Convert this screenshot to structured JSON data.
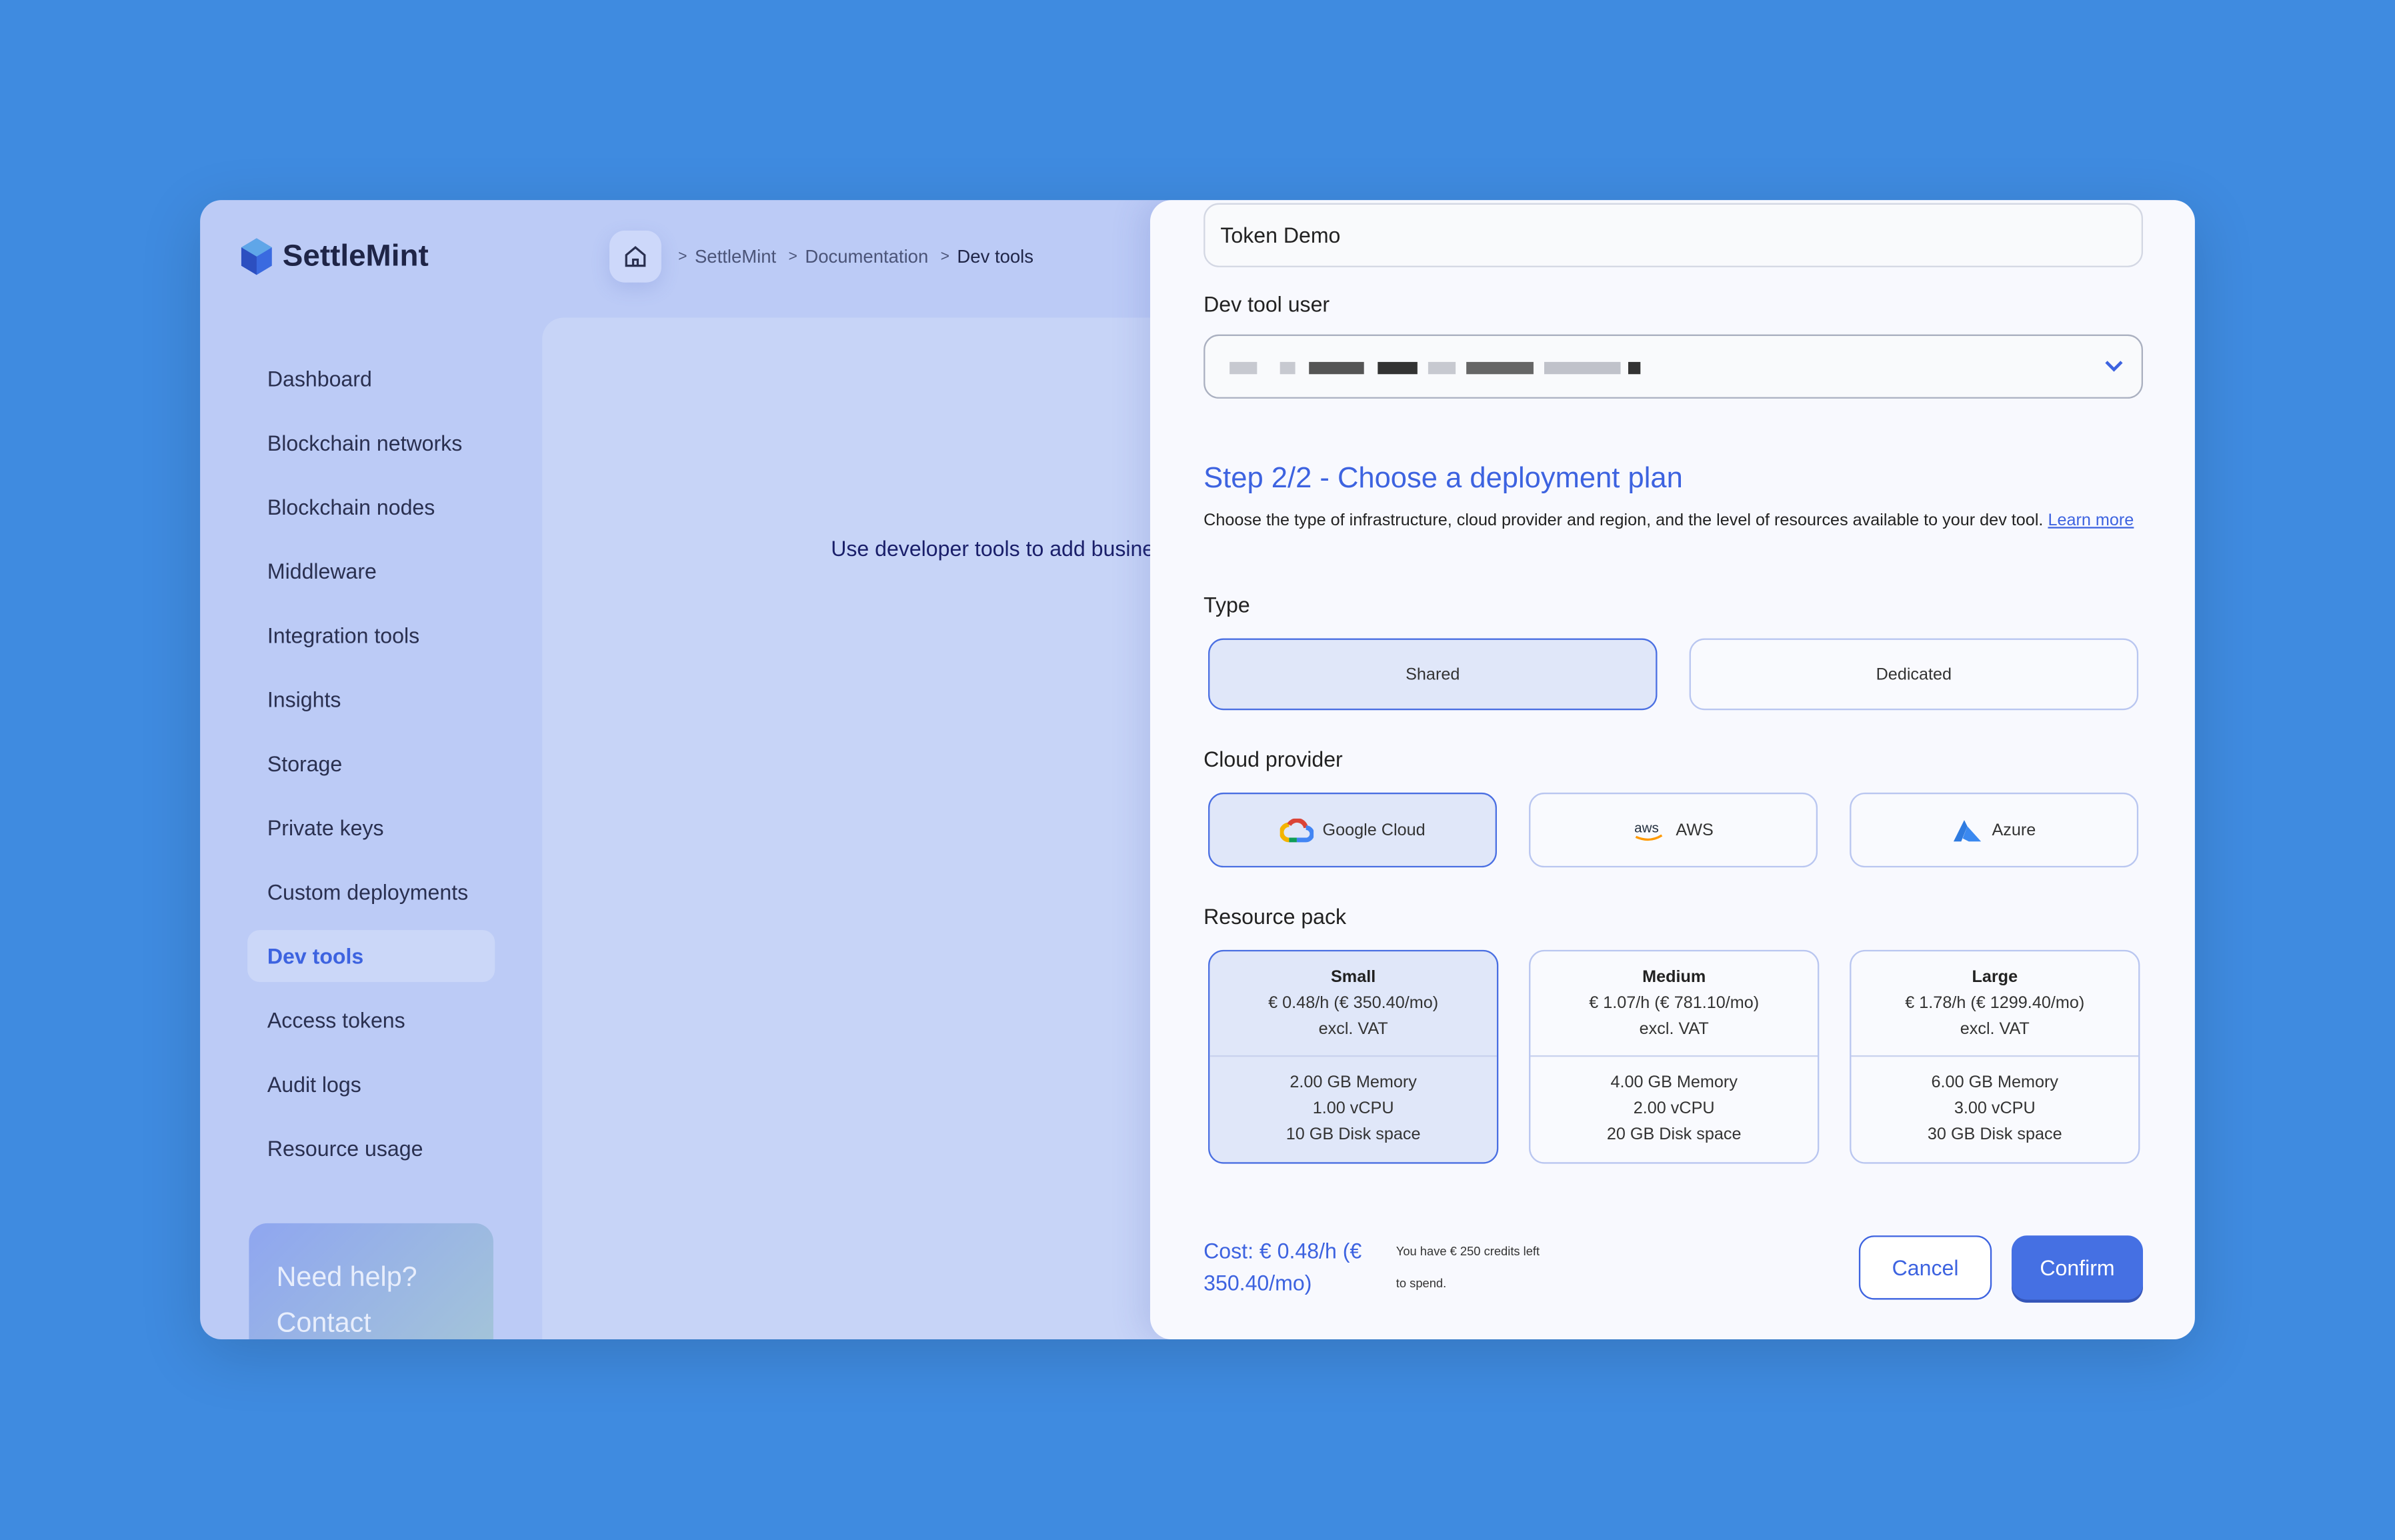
{
  "app": {
    "name": "SettleMint"
  },
  "breadcrumb": [
    "SettleMint",
    "Documentation",
    "Dev tools"
  ],
  "sidebar": {
    "items": [
      {
        "label": "Dashboard"
      },
      {
        "label": "Blockchain networks"
      },
      {
        "label": "Blockchain nodes"
      },
      {
        "label": "Middleware"
      },
      {
        "label": "Integration tools"
      },
      {
        "label": "Insights"
      },
      {
        "label": "Storage"
      },
      {
        "label": "Private keys"
      },
      {
        "label": "Custom deployments"
      },
      {
        "label": "Dev tools",
        "active": true
      },
      {
        "label": "Access tokens"
      },
      {
        "label": "Audit logs"
      },
      {
        "label": "Resource usage"
      }
    ],
    "help": {
      "line1": "Need help?",
      "line2": "Contact"
    }
  },
  "main": {
    "text": "Use developer tools to add busine"
  },
  "panel": {
    "name_value": "Token Demo",
    "user_label": "Dev tool user",
    "step_title": "Step 2/2 - Choose a deployment plan",
    "description": "Choose the type of infrastructure, cloud provider and region, and the level of resources available to your dev tool.",
    "learn_more": "Learn more",
    "type_label": "Type",
    "types": [
      {
        "label": "Shared",
        "selected": true
      },
      {
        "label": "Dedicated"
      }
    ],
    "cloud_label": "Cloud provider",
    "clouds": [
      {
        "label": "Google Cloud",
        "icon": "google-cloud-icon",
        "selected": true
      },
      {
        "label": "AWS",
        "icon": "aws-icon"
      },
      {
        "label": "Azure",
        "icon": "azure-icon"
      }
    ],
    "pack_label": "Resource pack",
    "packs": [
      {
        "name": "Small",
        "price": "€ 0.48/h (€ 350.40/mo)",
        "vat": "excl. VAT",
        "memory": "2.00 GB Memory",
        "cpu": "1.00 vCPU",
        "disk": "10 GB Disk space",
        "selected": true
      },
      {
        "name": "Medium",
        "price": "€ 1.07/h (€ 781.10/mo)",
        "vat": "excl. VAT",
        "memory": "4.00 GB Memory",
        "cpu": "2.00 vCPU",
        "disk": "20 GB Disk space"
      },
      {
        "name": "Large",
        "price": "€ 1.78/h (€ 1299.40/mo)",
        "vat": "excl. VAT",
        "memory": "6.00 GB Memory",
        "cpu": "3.00 vCPU",
        "disk": "30 GB Disk space"
      }
    ],
    "cost": "Cost: € 0.48/h (€ 350.40/mo)",
    "credits": "You have € 250 credits left to spend.",
    "cancel": "Cancel",
    "confirm": "Confirm"
  },
  "colors": {
    "accent": "#3d63e0",
    "background": "#3f8be0"
  }
}
